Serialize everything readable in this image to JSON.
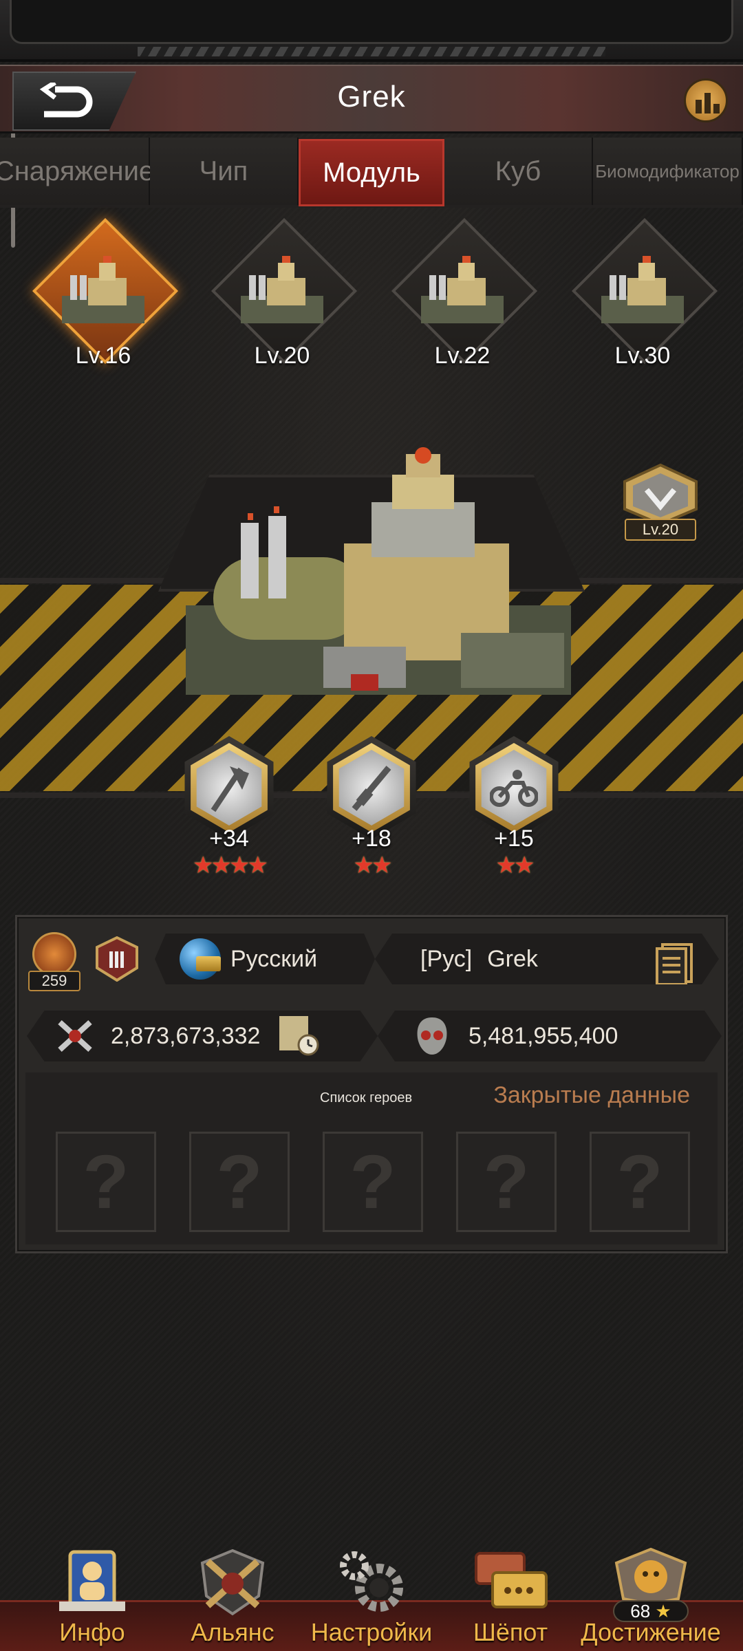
{
  "header": {
    "title": "Grek"
  },
  "tabs": [
    {
      "label": "Снаряжение"
    },
    {
      "label": "Чип"
    },
    {
      "label": "Модуль"
    },
    {
      "label": "Куб"
    },
    {
      "label": "Биомодификатор"
    }
  ],
  "active_tab": "Модуль",
  "modules": [
    {
      "level": "Lv.16",
      "selected": true
    },
    {
      "level": "Lv.20",
      "selected": false
    },
    {
      "level": "Lv.22",
      "selected": false
    },
    {
      "level": "Lv.30",
      "selected": false
    }
  ],
  "rank_badge": {
    "level": "Lv.20"
  },
  "skills": [
    {
      "bonus": "+34",
      "stars": "★★★★",
      "icon": "axe-icon"
    },
    {
      "bonus": "+18",
      "stars": "★★",
      "icon": "rifle-icon"
    },
    {
      "bonus": "+15",
      "stars": "★★",
      "icon": "motorcycle-icon"
    }
  ],
  "profile": {
    "likes": "259",
    "language": "Русский",
    "alliance_tag": "[Рус]",
    "name": "Grek",
    "power": "2,873,673,332",
    "kills": "5,481,955,400",
    "hero_list_label": "Список героев",
    "closed_data_label": "Закрытые данные",
    "hero_slots": [
      "?",
      "?",
      "?",
      "?",
      "?"
    ]
  },
  "nav": [
    {
      "label": "Инфо",
      "icon": "info-icon"
    },
    {
      "label": "Альянс",
      "icon": "alliance-icon"
    },
    {
      "label": "Настройки",
      "icon": "gear-icon"
    },
    {
      "label": "Шёпот",
      "icon": "chat-icon"
    },
    {
      "label": "Достижение",
      "icon": "achievement-icon"
    }
  ],
  "achievement_count": "68",
  "colors": {
    "accent_red": "#9b2a22",
    "gold": "#f0b84a",
    "closed_label": "#b97c4f"
  }
}
